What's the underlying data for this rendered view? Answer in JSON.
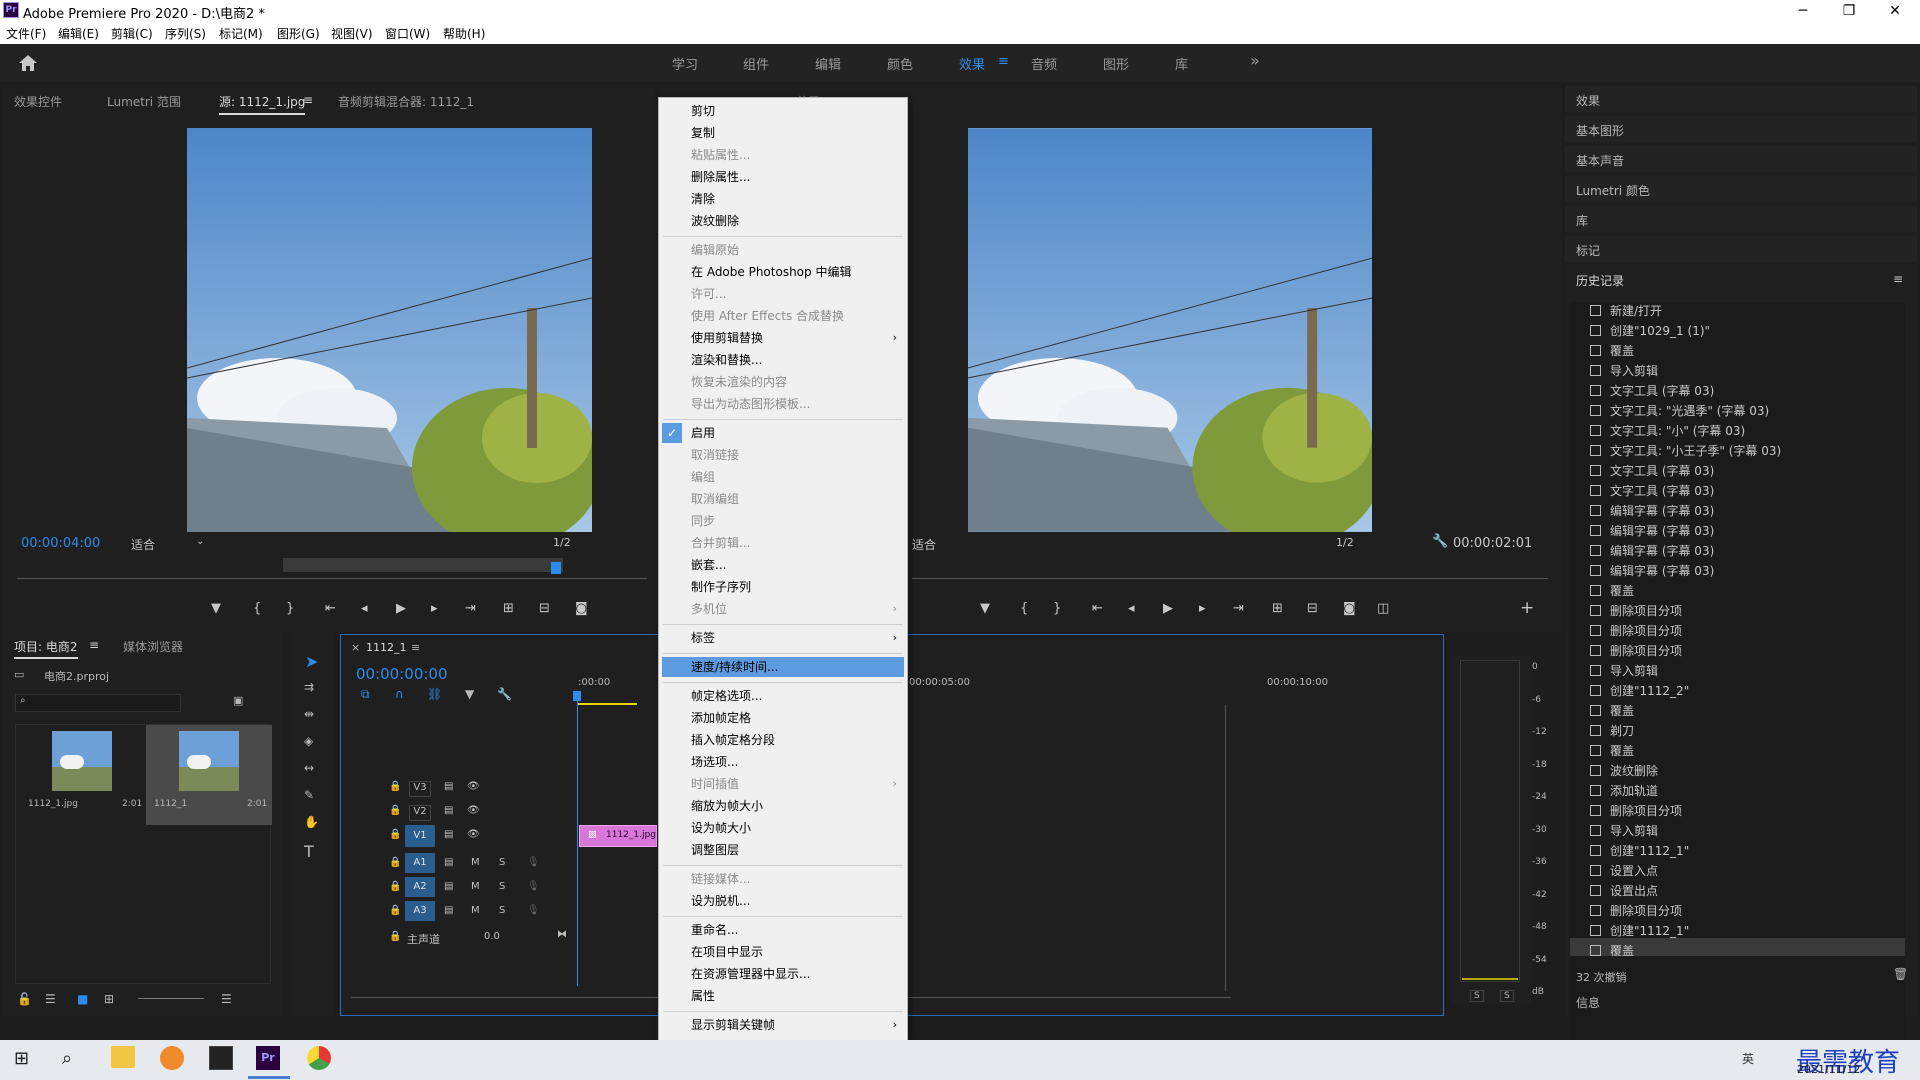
{
  "window": {
    "title": "Adobe Premiere Pro 2020 - D:\\电商2 *",
    "app_icon": "Pr",
    "minimize": "─",
    "maximize": "❐",
    "close": "✕"
  },
  "menu": [
    "文件(F)",
    "编辑(E)",
    "剪辑(C)",
    "序列(S)",
    "标记(M)",
    "图形(G)",
    "视图(V)",
    "窗口(W)",
    "帮助(H)"
  ],
  "workspaces": {
    "items": [
      "学习",
      "组件",
      "编辑",
      "颜色",
      "效果",
      "音频",
      "图形",
      "库"
    ],
    "active": "效果",
    "more": "»"
  },
  "source_panel": {
    "tabs": [
      "效果控件",
      "Lumetri 范围",
      "源: 1112_1.jpg",
      "音频剪辑混合器: 1112_1"
    ],
    "active_tab": "源: 1112_1.jpg",
    "timecode": "00:00:04:00",
    "fit": "适合",
    "resolution": "1/2"
  },
  "program_panel": {
    "tab_partial": "节目: 1112_1",
    "fit": "适合",
    "resolution": "1/2",
    "timecode": "00:00:02:01"
  },
  "right_panels": [
    "效果",
    "基本图形",
    "基本声音",
    "Lumetri 颜色",
    "库",
    "标记"
  ],
  "history": {
    "title": "历史记录",
    "entries": [
      "新建/打开",
      "创建\"1029_1 (1)\"",
      "覆盖",
      "导入剪辑",
      "文字工具 (字幕 03)",
      "文字工具: \"光遇季\" (字幕 03)",
      "文字工具: \"小\" (字幕 03)",
      "文字工具: \"小王子季\" (字幕 03)",
      "文字工具 (字幕 03)",
      "文字工具 (字幕 03)",
      "编辑字幕 (字幕 03)",
      "编辑字幕 (字幕 03)",
      "编辑字幕 (字幕 03)",
      "编辑字幕 (字幕 03)",
      "覆盖",
      "删除项目分项",
      "删除项目分项",
      "删除项目分项",
      "导入剪辑",
      "创建\"1112_2\"",
      "覆盖",
      "剃刀",
      "覆盖",
      "波纹删除",
      "添加轨道",
      "删除项目分项",
      "导入剪辑",
      "创建\"1112_1\"",
      "设置入点",
      "设置出点",
      "删除项目分项",
      "创建\"1112_1\"",
      "覆盖"
    ],
    "undo_count": "32 次撤销",
    "info": "信息"
  },
  "project_panel": {
    "tabs": [
      "项目: 电商2",
      "媒体浏览器"
    ],
    "file": "电商2.prproj",
    "items": [
      {
        "name": "1112_1.jpg",
        "dur": "2:01"
      },
      {
        "name": "1112_1",
        "dur": "2:01"
      }
    ]
  },
  "timeline": {
    "seq_tab": "1112_1",
    "timecode": "00:00:00:00",
    "ruler": [
      ":00:00",
      "00:00:05:00",
      "00:00:10:00"
    ],
    "video_tracks": [
      "V3",
      "V2",
      "V1"
    ],
    "audio_tracks": [
      "A1",
      "A2",
      "A3"
    ],
    "master": "主声道",
    "master_val": "0.0",
    "clip": "1112_1.jpg",
    "m": "M",
    "s": "S"
  },
  "meter": {
    "scale": [
      "0",
      "-6",
      "-12",
      "-18",
      "-24",
      "-30",
      "-36",
      "-42",
      "-48",
      "-54",
      "dB"
    ],
    "s": "S"
  },
  "context_menu": {
    "items": [
      {
        "label": "剪切",
        "enabled": true
      },
      {
        "label": "复制",
        "enabled": true
      },
      {
        "label": "粘贴属性...",
        "enabled": false
      },
      {
        "label": "删除属性...",
        "enabled": true
      },
      {
        "label": "清除",
        "enabled": true
      },
      {
        "label": "波纹删除",
        "enabled": true
      },
      {
        "label": "编辑原始",
        "enabled": false
      },
      {
        "label": "在 Adobe Photoshop 中编辑",
        "enabled": true
      },
      {
        "label": "许可...",
        "enabled": false
      },
      {
        "label": "使用 After Effects 合成替换",
        "enabled": false
      },
      {
        "label": "使用剪辑替换",
        "enabled": true,
        "submenu": true
      },
      {
        "label": "渲染和替换...",
        "enabled": true
      },
      {
        "label": "恢复未渲染的内容",
        "enabled": false
      },
      {
        "label": "导出为动态图形模板...",
        "enabled": false
      },
      {
        "label": "启用",
        "enabled": true,
        "checked": true
      },
      {
        "label": "取消链接",
        "enabled": false
      },
      {
        "label": "编组",
        "enabled": false
      },
      {
        "label": "取消编组",
        "enabled": false
      },
      {
        "label": "同步",
        "enabled": false
      },
      {
        "label": "合并剪辑...",
        "enabled": false
      },
      {
        "label": "嵌套...",
        "enabled": true
      },
      {
        "label": "制作子序列",
        "enabled": true
      },
      {
        "label": "多机位",
        "enabled": false,
        "submenu": true
      },
      {
        "label": "标签",
        "enabled": true,
        "submenu": true
      },
      {
        "label": "速度/持续时间...",
        "enabled": true,
        "highlighted": true
      },
      {
        "label": "帧定格选项...",
        "enabled": true
      },
      {
        "label": "添加帧定格",
        "enabled": true
      },
      {
        "label": "插入帧定格分段",
        "enabled": true
      },
      {
        "label": "场选项...",
        "enabled": true
      },
      {
        "label": "时间插值",
        "enabled": false,
        "submenu": true
      },
      {
        "label": "缩放为帧大小",
        "enabled": true
      },
      {
        "label": "设为帧大小",
        "enabled": true
      },
      {
        "label": "调整图层",
        "enabled": true
      },
      {
        "label": "链接媒体...",
        "enabled": false
      },
      {
        "label": "设为脱机...",
        "enabled": true
      },
      {
        "label": "重命名...",
        "enabled": true
      },
      {
        "label": "在项目中显示",
        "enabled": true
      },
      {
        "label": "在资源管理器中显示...",
        "enabled": true
      },
      {
        "label": "属性",
        "enabled": true
      },
      {
        "label": "显示剪辑关键帧",
        "enabled": true,
        "submenu": true
      }
    ]
  },
  "taskbar": {
    "date": "2021/11/12",
    "watermark": "最需教育",
    "ime": "英"
  }
}
